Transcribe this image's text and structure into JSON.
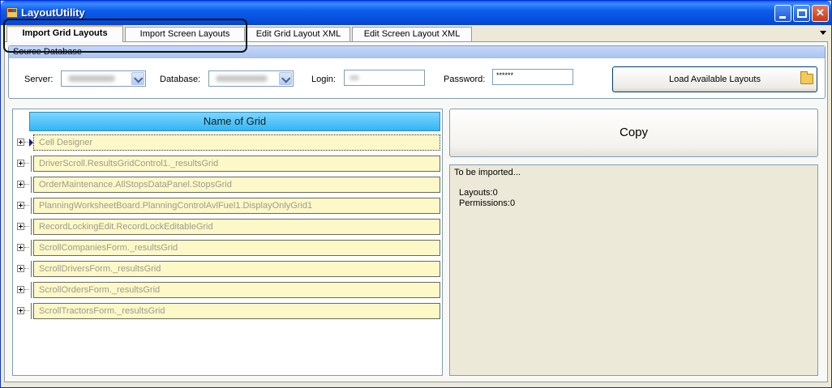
{
  "window": {
    "title": "LayoutUtility",
    "controls": [
      "minimize",
      "maximize",
      "close"
    ]
  },
  "tabs": [
    {
      "label": "Import Grid Layouts",
      "active": true
    },
    {
      "label": "Import Screen Layouts",
      "active": false
    },
    {
      "label": "Edit Grid Layout XML",
      "active": false
    },
    {
      "label": "Edit Screen Layout XML",
      "active": false
    }
  ],
  "source_database": {
    "header": "Source Database",
    "server_label": "Server:",
    "database_label": "Database:",
    "login_label": "Login:",
    "password_label": "Password:",
    "password_value": "******",
    "load_button": "Load Available Layouts"
  },
  "grid": {
    "column_header": "Name of Grid",
    "rows": [
      "Cell Designer",
      "DriverScroll.ResultsGridControl1._resultsGrid",
      "OrderMaintenance.AllStopsDataPanel.StopsGrid",
      "PlanningWorksheetBoard.PlanningControlAvlFuel1.DisplayOnlyGrid1",
      "RecordLockingEdit.RecordLockEditableGrid",
      "ScrollCompaniesForm._resultsGrid",
      "ScrollDriversForm._resultsGrid",
      "ScrollOrdersForm._resultsGrid",
      "ScrollTractorsForm._resultsGrid"
    ]
  },
  "copy_button": "Copy",
  "status": {
    "title": "To be imported...",
    "layouts": "Layouts:0",
    "permissions": "Permissions:0"
  },
  "colors": {
    "titlebar": "#0A5BF0",
    "grid_header": "#33B5F5",
    "row_fill": "#FDF8C8",
    "window_bg": "#ECE9D8"
  }
}
